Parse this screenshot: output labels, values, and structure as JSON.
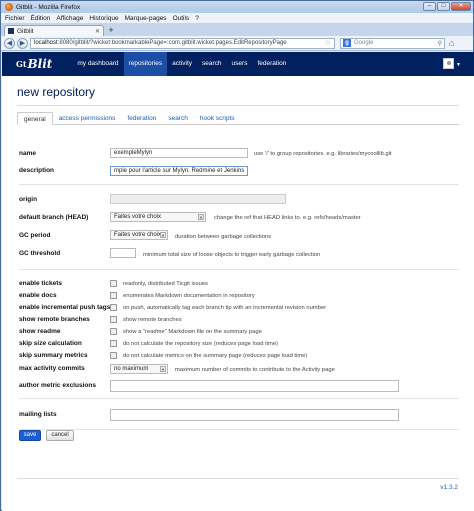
{
  "window": {
    "title": "Gitblit - Mozilla Firefox",
    "menu": [
      "Fichier",
      "Édition",
      "Affichage",
      "Historique",
      "Marque-pages",
      "Outils",
      "?"
    ],
    "tab_title": "Gitblit",
    "url_host": "localhost",
    "url_rest": ":8080/gitblit/?wicket:bookmarkablePage=:com.gitblit.wicket.pages.EditRepositoryPage",
    "search_placeholder": "Google"
  },
  "app": {
    "logo": "Blit",
    "logo_prefix": "Gt",
    "nav": [
      "my dashboard",
      "repositories",
      "activity",
      "search",
      "users",
      "federation"
    ],
    "active_nav": "repositories"
  },
  "page": {
    "title": "new repository",
    "tabs": [
      "general",
      "access permissions",
      "federation",
      "search",
      "hook scripts"
    ]
  },
  "form": {
    "name_label": "name",
    "name_value": "exempleMylyn",
    "name_help": "use '/' to group repositories. e.g. libraries/mycoollib.git",
    "description_label": "description",
    "description_value": "mple pour l'article sur Mylyn, Redmine et Jenkins",
    "origin_label": "origin",
    "default_branch_label": "default branch (HEAD)",
    "default_branch_value": "Faites votre choix",
    "default_branch_help": "change the ref that HEAD links to. e.g. refs/heads/master",
    "gc_period_label": "GC period",
    "gc_period_value": "Faites votre choix",
    "gc_period_help": "duration between garbage collections",
    "gc_threshold_label": "GC threshold",
    "gc_threshold_help": "minimum total size of loose objects to trigger early garbage collection",
    "checks": [
      {
        "label": "enable tickets",
        "help": "readonly, distributed Ticgit issues"
      },
      {
        "label": "enable docs",
        "help": "enumerates Markdown documentation in repository"
      },
      {
        "label": "enable incremental push tags",
        "help": "on push, automatically tag each branch tip with an incremental revision number"
      },
      {
        "label": "show remote branches",
        "help": "show remote branches"
      },
      {
        "label": "show readme",
        "help": "show a \"readme\" Markdown file on the summary page"
      },
      {
        "label": "skip size calculation",
        "help": "do not calculate the repository size (reduces page load time)"
      },
      {
        "label": "skip summary metrics",
        "help": "do not calculate metrics on the summary page (reduces page load time)"
      }
    ],
    "max_commits_label": "max activity commits",
    "max_commits_value": "no maximum",
    "max_commits_help": "maximum number of commits to contribute to the Activity page",
    "author_exclusions_label": "author metric exclusions",
    "mailing_lists_label": "mailing lists",
    "save_label": "save",
    "cancel_label": "cancel"
  },
  "footer": {
    "version": "v1.3.2"
  }
}
